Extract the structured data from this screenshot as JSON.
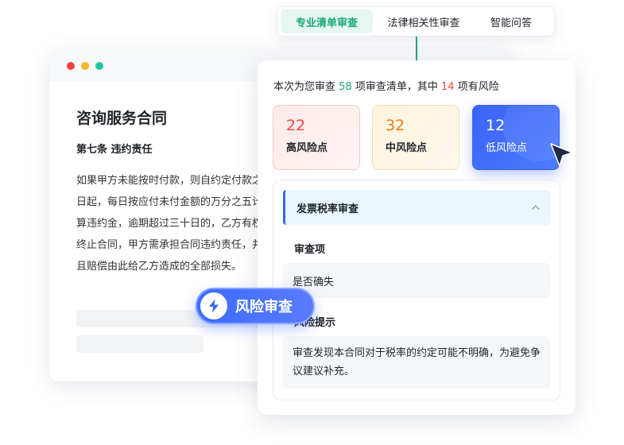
{
  "tabs": [
    {
      "label": "专业清单审查",
      "active": true
    },
    {
      "label": "法律相关性审查",
      "active": false
    },
    {
      "label": "智能问答",
      "active": false
    }
  ],
  "document": {
    "title": "咨询服务合同",
    "section": "第七条 违约责任",
    "paragraph": "如果甲方未能按时付款，则自约定付款之日起，每日按应付未付金额的万分之五计算违约金，逾期超过三十日的，乙方有权终止合同，甲方需承担合同违约责任，并且赔偿由此给乙方造成的全部损失。"
  },
  "risk_button": {
    "label": "风险审查",
    "icon": "lightning-icon"
  },
  "summary": {
    "prefix": "本次为您审查",
    "total": "58",
    "middle": "项审查清单，其中",
    "risky": "14",
    "suffix": "项有风险"
  },
  "risk_cards": {
    "high": {
      "value": "22",
      "label": "高风险点"
    },
    "mid": {
      "value": "32",
      "label": "中风险点"
    },
    "low": {
      "value": "12",
      "label": "低风险点"
    }
  },
  "detail": {
    "title": "发票税率审查",
    "item_label": "审查项",
    "item_value": "是否确失",
    "hint_label": "风险提示",
    "hint_value": "审查发现本合同对于税率的约定可能不明确，为避免争议建议补充。"
  },
  "colors": {
    "accent_green": "#1aa77b",
    "accent_blue": "#3a63f5",
    "risk_red": "#f0483e",
    "risk_orange": "#f07a1a"
  }
}
